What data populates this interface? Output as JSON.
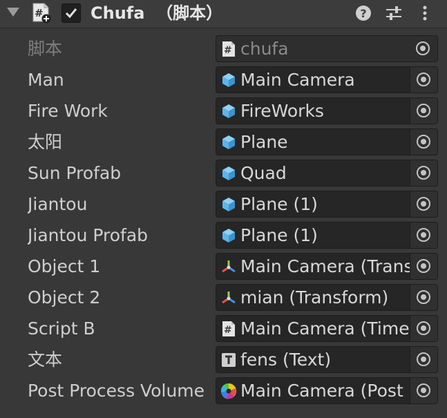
{
  "component": {
    "title": "Chufa  （脚本）",
    "enabled": true,
    "folded": false
  },
  "header_icons": [
    "script-component-icon",
    "checkbox-icon",
    "help-icon",
    "presets-icon",
    "kebab-menu-icon"
  ],
  "fields": [
    {
      "label": "脚本",
      "value": "chufa",
      "icon": "script-icon",
      "disabled": true
    },
    {
      "label": "Man",
      "value": "Main Camera",
      "icon": "gameobject-cube-icon"
    },
    {
      "label": "Fire Work",
      "value": "FireWorks",
      "icon": "gameobject-cube-icon"
    },
    {
      "label": "太阳",
      "value": "Plane",
      "icon": "gameobject-cube-icon"
    },
    {
      "label": "Sun Profab",
      "value": "Quad",
      "icon": "gameobject-cube-icon"
    },
    {
      "label": "Jiantou",
      "value": "Plane (1)",
      "icon": "gameobject-cube-icon"
    },
    {
      "label": "Jiantou Profab",
      "value": "Plane (1)",
      "icon": "gameobject-cube-icon"
    },
    {
      "label": "Object 1",
      "value": "Main Camera (Transform)",
      "icon": "transform-icon"
    },
    {
      "label": "Object 2",
      "value": "mian (Transform)",
      "icon": "transform-icon"
    },
    {
      "label": "Script B",
      "value": "Main Camera (Time)",
      "icon": "script-icon"
    },
    {
      "label": "文本",
      "value": "fens (Text)",
      "icon": "text-icon"
    },
    {
      "label": "Post Process Volume",
      "value": "Main Camera (Post Process Volume)",
      "icon": "post-process-icon"
    }
  ],
  "colors": {
    "background": "#383838",
    "field_background": "#262626",
    "cube_blue": "#5fb4ea"
  }
}
